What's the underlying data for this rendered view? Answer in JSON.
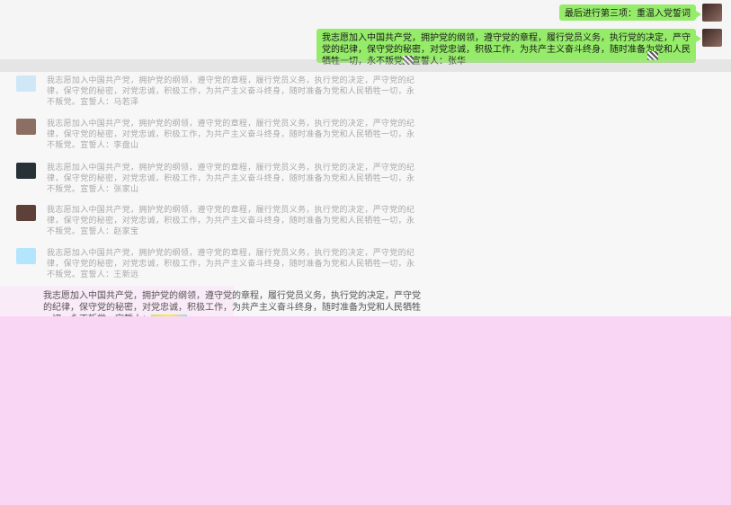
{
  "chat": {
    "header_message": "最后进行第三项：重温入党誓词",
    "oath_full": "我志愿加入中国共产党，拥护党的纲领，遵守党的章程，履行党员义务，执行党的决定，严守党的纪律，保守党的秘密，对党忠诚，积极工作，为共产主义奋斗终身，随时准备为党和人民牺牲一切，永不叛党。宣誓人：张华",
    "replies": [
      {
        "text": "我志愿加入中国共产党，拥护党的纲领，遵守党的章程，履行党员义务，执行党的决定，严守党的纪律，保守党的秘密，对党忠诚，积极工作，为共产主义奋斗终身，随时准备为党和人民牺牲一切，永不叛党。宣誓人：马若泽",
        "avatar_color": "#cfe7f7"
      },
      {
        "text": "我志愿加入中国共产党，拥护党的纲领，遵守党的章程，履行党员义务，执行党的决定，严守党的纪律，保守党的秘密，对党忠诚，积极工作，为共产主义奋斗终身，随时准备为党和人民牺牲一切，永不叛党。宣誓人：李盘山",
        "avatar_color": "#8d6e63"
      },
      {
        "text": "我志愿加入中国共产党，拥护党的纲领，遵守党的章程，履行党员义务，执行党的决定，严守党的纪律，保守党的秘密，对党忠诚，积极工作，为共产主义奋斗终身，随时准备为党和人民牺牲一切，永不叛党。宣誓人：张家山",
        "avatar_color": "#263238"
      },
      {
        "text": "我志愿加入中国共产党，拥护党的纲领，遵守党的章程，履行党员义务，执行党的决定，严守党的纪律，保守党的秘密，对党忠诚，积极工作，为共产主义奋斗终身，随时准备为党和人民牺牲一切，永不叛党。宣誓人：赵家宝",
        "avatar_color": "#5d4037"
      },
      {
        "text": "我志愿加入中国共产党，拥护党的纲领，遵守党的章程，履行党员义务，执行党的决定，严守党的纪律，保守党的秘密，对党忠诚，积极工作，为共产主义奋斗终身，随时准备为党和人民牺牲一切，永不叛党。宣誓人：王新远",
        "avatar_color": "#b3e5fc"
      }
    ],
    "partial": "我志愿加入中国共产党，拥护党的纲领，遵守党的章程，履行党员义务，执行党的决定，严守党的纪律，保守党的秘密，对党忠诚，积极工作，为共产主义奋斗终身，随时准备为党和人民牺牲一切，永不叛党。宣誓人："
  },
  "colors": {
    "green_bubble": "#95ec69",
    "pink_overlay": "#f8d6f4"
  }
}
